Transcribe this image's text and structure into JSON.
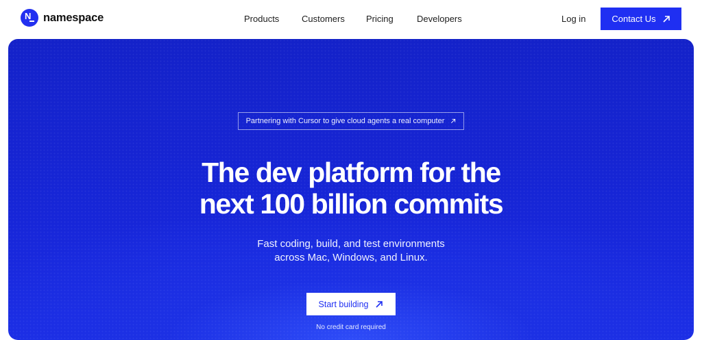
{
  "brand": {
    "name": "namespace",
    "logo_letter": "N"
  },
  "nav": {
    "items": [
      {
        "label": "Products"
      },
      {
        "label": "Customers"
      },
      {
        "label": "Pricing"
      },
      {
        "label": "Developers"
      }
    ],
    "login_label": "Log in",
    "contact_label": "Contact Us"
  },
  "hero": {
    "announcement": "Partnering with Cursor to give cloud agents a real computer",
    "headline_line1": "The dev platform for the",
    "headline_line2": "next 100 billion commits",
    "sub_line1": "Fast coding, build, and test environments",
    "sub_line2": "across Mac, Windows, and Linux.",
    "cta_label": "Start building",
    "note": "No credit card required"
  },
  "colors": {
    "accent": "#1f2ff2",
    "hero_bg": "#1726d8",
    "text": "#111111"
  },
  "icons": {
    "external_arrow": "arrow-up-right-icon"
  }
}
